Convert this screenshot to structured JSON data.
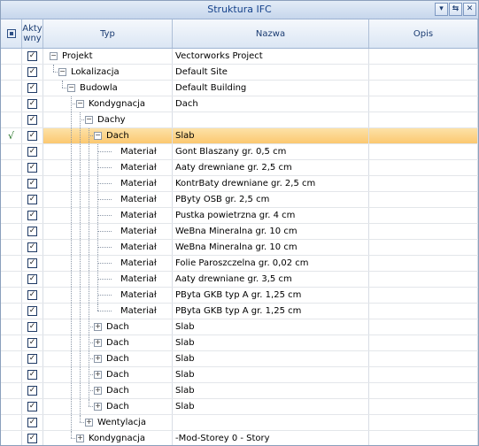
{
  "window": {
    "title": "Struktura IFC"
  },
  "title_buttons": [
    {
      "name": "dropdown-button",
      "glyph": "▾"
    },
    {
      "name": "pin-button",
      "glyph": "⇆"
    },
    {
      "name": "close-button",
      "glyph": "✕"
    }
  ],
  "columns": {
    "active": "Akty\nwny",
    "type": "Typ",
    "name": "Nazwa",
    "description": "Opis"
  },
  "rows": [
    {
      "level": 0,
      "toggle": "minus",
      "type": "Projekt",
      "name": "Vectorworks Project",
      "checked": true
    },
    {
      "level": 1,
      "toggle": "minus",
      "type": "Lokalizacja",
      "name": "Default Site",
      "checked": true
    },
    {
      "level": 2,
      "toggle": "minus",
      "type": "Budowla",
      "name": "Default Building",
      "checked": true
    },
    {
      "level": 3,
      "toggle": "minus",
      "type": "Kondygnacja",
      "name": "Dach",
      "checked": true
    },
    {
      "level": 4,
      "toggle": "minus",
      "type": "Dachy",
      "name": "",
      "checked": true
    },
    {
      "level": 5,
      "toggle": "minus",
      "type": "Dach",
      "name": "Slab",
      "checked": true,
      "selected": true,
      "marker": "√"
    },
    {
      "level": 6,
      "toggle": "none",
      "type": "Materiał",
      "name": "Gont Blaszany gr. 0,5 cm",
      "checked": true
    },
    {
      "level": 6,
      "toggle": "none",
      "type": "Materiał",
      "name": "Aaty drewniane gr. 2,5 cm",
      "checked": true
    },
    {
      "level": 6,
      "toggle": "none",
      "type": "Materiał",
      "name": "KontrBaty drewniane gr. 2,5 cm",
      "checked": true
    },
    {
      "level": 6,
      "toggle": "none",
      "type": "Materiał",
      "name": "PByty OSB gr. 2,5 cm",
      "checked": true
    },
    {
      "level": 6,
      "toggle": "none",
      "type": "Materiał",
      "name": "Pustka powietrzna gr. 4 cm",
      "checked": true
    },
    {
      "level": 6,
      "toggle": "none",
      "type": "Materiał",
      "name": "WeBna Mineralna gr. 10 cm",
      "checked": true
    },
    {
      "level": 6,
      "toggle": "none",
      "type": "Materiał",
      "name": "WeBna Mineralna gr. 10 cm",
      "checked": true
    },
    {
      "level": 6,
      "toggle": "none",
      "type": "Materiał",
      "name": "Folie Paroszczelna gr. 0,02 cm",
      "checked": true
    },
    {
      "level": 6,
      "toggle": "none",
      "type": "Materiał",
      "name": "Aaty drewniane gr. 3,5 cm",
      "checked": true
    },
    {
      "level": 6,
      "toggle": "none",
      "type": "Materiał",
      "name": "PByta GKB typ A gr. 1,25 cm",
      "checked": true
    },
    {
      "level": 6,
      "toggle": "none",
      "type": "Materiał",
      "name": "PByta GKB typ A gr. 1,25 cm",
      "checked": true
    },
    {
      "level": 5,
      "toggle": "plus",
      "type": "Dach",
      "name": "Slab",
      "checked": true
    },
    {
      "level": 5,
      "toggle": "plus",
      "type": "Dach",
      "name": "Slab",
      "checked": true
    },
    {
      "level": 5,
      "toggle": "plus",
      "type": "Dach",
      "name": "Slab",
      "checked": true
    },
    {
      "level": 5,
      "toggle": "plus",
      "type": "Dach",
      "name": "Slab",
      "checked": true
    },
    {
      "level": 5,
      "toggle": "plus",
      "type": "Dach",
      "name": "Slab",
      "checked": true
    },
    {
      "level": 5,
      "toggle": "plus",
      "type": "Dach",
      "name": "Slab",
      "checked": true
    },
    {
      "level": 4,
      "toggle": "plus",
      "type": "Wentylacja",
      "name": "",
      "checked": true
    },
    {
      "level": 3,
      "toggle": "plus",
      "type": "Kondygnacja",
      "name": "-Mod-Storey 0 - Story",
      "checked": true
    }
  ],
  "colors": {
    "selection": "#fbc870",
    "header_text": "#15428b",
    "border": "#8ba0bc"
  }
}
